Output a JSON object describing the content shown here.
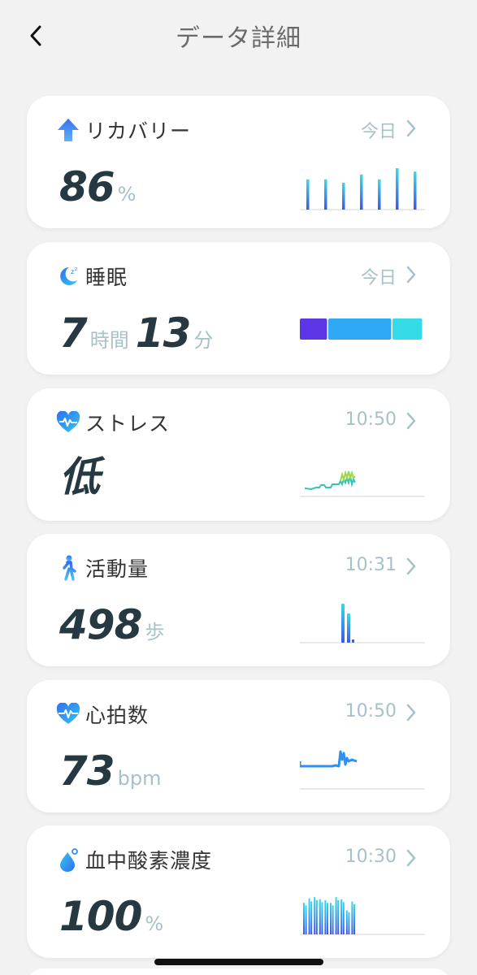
{
  "header": {
    "title": "データ詳細",
    "back_icon": "chevron-left-icon"
  },
  "cards": {
    "recovery": {
      "label": "リカバリー",
      "time": "今日",
      "value": "86",
      "unit": "%",
      "icon": "arrow-up-icon",
      "bars": [
        0.62,
        0.62,
        0.55,
        0.72,
        0.62,
        0.85,
        0.78
      ]
    },
    "sleep": {
      "label": "睡眠",
      "time": "今日",
      "hours": "7",
      "hours_unit": "時間",
      "minutes": "13",
      "minutes_unit": "分",
      "icon": "moon-icon",
      "stages": [
        {
          "share": 0.23,
          "color": "#5b35e6"
        },
        {
          "share": 0.52,
          "color": "#2ea8f2"
        },
        {
          "share": 0.25,
          "color": "#36dbe8"
        }
      ]
    },
    "stress": {
      "label": "ストレス",
      "time": "10:50",
      "value": "低",
      "icon": "heart-wave-icon"
    },
    "activity": {
      "label": "活動量",
      "time": "10:31",
      "value": "498",
      "unit": "歩",
      "icon": "walking-icon"
    },
    "heart_rate": {
      "label": "心拍数",
      "time": "10:50",
      "value": "73",
      "unit": "bpm",
      "icon": "heart-pulse-icon"
    },
    "spo2": {
      "label": "血中酸素濃度",
      "time": "10:30",
      "value": "100",
      "unit": "%",
      "icon": "droplet-icon",
      "bars": [
        0.72,
        0.82,
        0.85,
        0.8,
        0.78,
        0.72,
        0.85,
        0.8,
        0.55,
        0.75
      ]
    }
  },
  "colors": {
    "accent_blue": "#2f7cf6",
    "teal": "#36dbe8",
    "value_dark": "#263841",
    "muted": "#a7c1c9"
  }
}
